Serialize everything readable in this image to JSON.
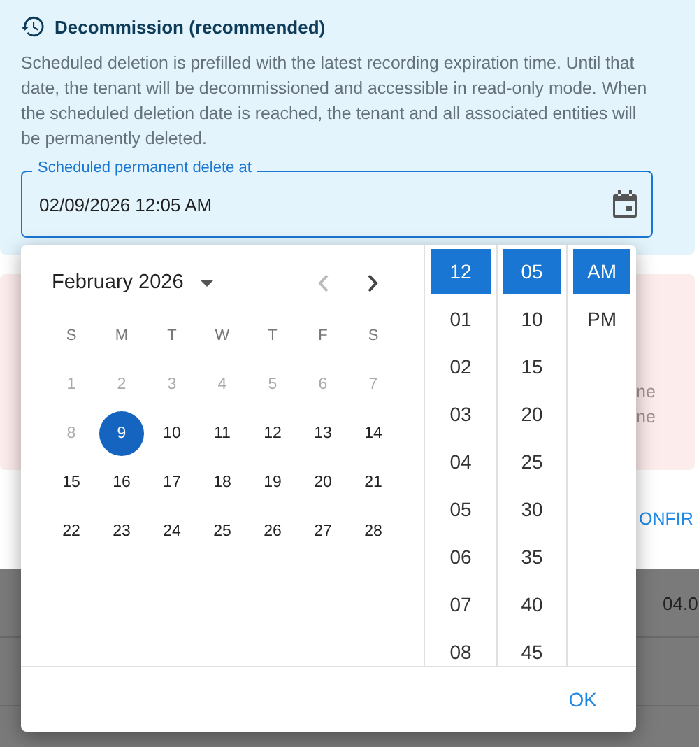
{
  "info_panel": {
    "title": "Decommission (recommended)",
    "description": "Scheduled deletion is prefilled with the latest recording expiration time. Until that date, the tenant will be decommissioned and accessible in read-only mode. When the scheduled deletion date is reached, the tenant and all associated entities will be permanently deleted.",
    "date_field": {
      "label": "Scheduled permanent delete at",
      "value": "02/09/2026 12:05 AM"
    }
  },
  "warning_panel": {
    "text_lines": [
      "ne",
      "ne"
    ]
  },
  "dialog_actions": [
    {
      "label": "ONFIR"
    }
  ],
  "background_table": {
    "cells": [
      "04.0"
    ]
  },
  "date_picker": {
    "month_label": "February 2026",
    "prev_month_disabled": true,
    "next_month_disabled": false,
    "weekdays": [
      "S",
      "M",
      "T",
      "W",
      "T",
      "F",
      "S"
    ],
    "weeks": [
      [
        {
          "day": "1",
          "disabled": true,
          "selected": false
        },
        {
          "day": "2",
          "disabled": true,
          "selected": false
        },
        {
          "day": "3",
          "disabled": true,
          "selected": false
        },
        {
          "day": "4",
          "disabled": true,
          "selected": false
        },
        {
          "day": "5",
          "disabled": true,
          "selected": false
        },
        {
          "day": "6",
          "disabled": true,
          "selected": false
        },
        {
          "day": "7",
          "disabled": true,
          "selected": false
        }
      ],
      [
        {
          "day": "8",
          "disabled": true,
          "selected": false
        },
        {
          "day": "9",
          "disabled": false,
          "selected": true
        },
        {
          "day": "10",
          "disabled": false,
          "selected": false
        },
        {
          "day": "11",
          "disabled": false,
          "selected": false
        },
        {
          "day": "12",
          "disabled": false,
          "selected": false
        },
        {
          "day": "13",
          "disabled": false,
          "selected": false
        },
        {
          "day": "14",
          "disabled": false,
          "selected": false
        }
      ],
      [
        {
          "day": "15",
          "disabled": false,
          "selected": false
        },
        {
          "day": "16",
          "disabled": false,
          "selected": false
        },
        {
          "day": "17",
          "disabled": false,
          "selected": false
        },
        {
          "day": "18",
          "disabled": false,
          "selected": false
        },
        {
          "day": "19",
          "disabled": false,
          "selected": false
        },
        {
          "day": "20",
          "disabled": false,
          "selected": false
        },
        {
          "day": "21",
          "disabled": false,
          "selected": false
        }
      ],
      [
        {
          "day": "22",
          "disabled": false,
          "selected": false
        },
        {
          "day": "23",
          "disabled": false,
          "selected": false
        },
        {
          "day": "24",
          "disabled": false,
          "selected": false
        },
        {
          "day": "25",
          "disabled": false,
          "selected": false
        },
        {
          "day": "26",
          "disabled": false,
          "selected": false
        },
        {
          "day": "27",
          "disabled": false,
          "selected": false
        },
        {
          "day": "28",
          "disabled": false,
          "selected": false
        }
      ]
    ],
    "hours": [
      {
        "label": "12",
        "selected": true
      },
      {
        "label": "01",
        "selected": false
      },
      {
        "label": "02",
        "selected": false
      },
      {
        "label": "03",
        "selected": false
      },
      {
        "label": "04",
        "selected": false
      },
      {
        "label": "05",
        "selected": false
      },
      {
        "label": "06",
        "selected": false
      },
      {
        "label": "07",
        "selected": false
      },
      {
        "label": "08",
        "selected": false
      }
    ],
    "minutes": [
      {
        "label": "05",
        "selected": true
      },
      {
        "label": "10",
        "selected": false
      },
      {
        "label": "15",
        "selected": false
      },
      {
        "label": "20",
        "selected": false
      },
      {
        "label": "25",
        "selected": false
      },
      {
        "label": "30",
        "selected": false
      },
      {
        "label": "35",
        "selected": false
      },
      {
        "label": "40",
        "selected": false
      },
      {
        "label": "45",
        "selected": false
      }
    ],
    "meridiem": [
      {
        "label": "AM",
        "selected": true
      },
      {
        "label": "PM",
        "selected": false
      }
    ],
    "actions": [
      "OK"
    ]
  }
}
